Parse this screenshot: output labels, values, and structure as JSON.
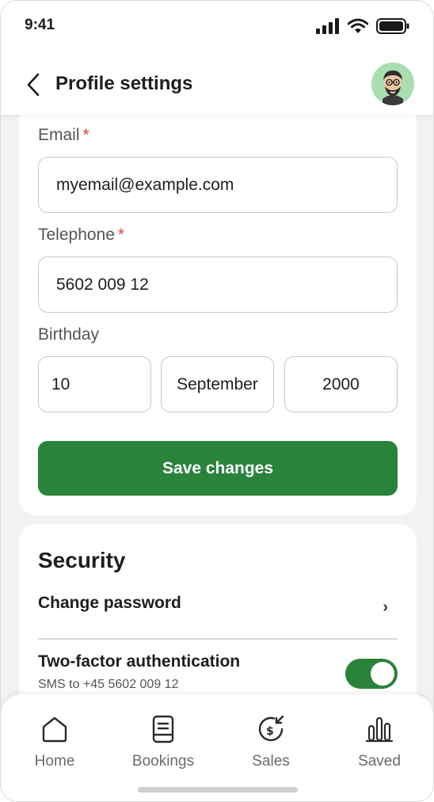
{
  "status": {
    "time": "9:41"
  },
  "header": {
    "title": "Profile settings"
  },
  "form": {
    "email": {
      "label": "Email",
      "required": "*",
      "value": "myemail@example.com"
    },
    "telephone": {
      "label": "Telephone",
      "required": "*",
      "value": "5602 009 12"
    },
    "birthday": {
      "label": "Birthday",
      "day": "10",
      "month": "September",
      "year": "2000"
    },
    "save_label": "Save changes"
  },
  "security": {
    "title": "Security",
    "change_password": "Change password",
    "chevron": "›",
    "two_factor": {
      "title": "Two-factor authentication",
      "subtitle": "SMS to +45 5602 009 12",
      "enabled": true
    }
  },
  "nav": {
    "items": [
      {
        "label": "Home",
        "icon": "home-icon"
      },
      {
        "label": "Bookings",
        "icon": "bookings-icon"
      },
      {
        "label": "Sales",
        "icon": "sales-icon"
      },
      {
        "label": "Saved",
        "icon": "saved-chart-icon"
      }
    ]
  },
  "colors": {
    "accent": "#2a833b",
    "required": "#e23b3b",
    "avatar_bg": "#a9dfb0"
  }
}
